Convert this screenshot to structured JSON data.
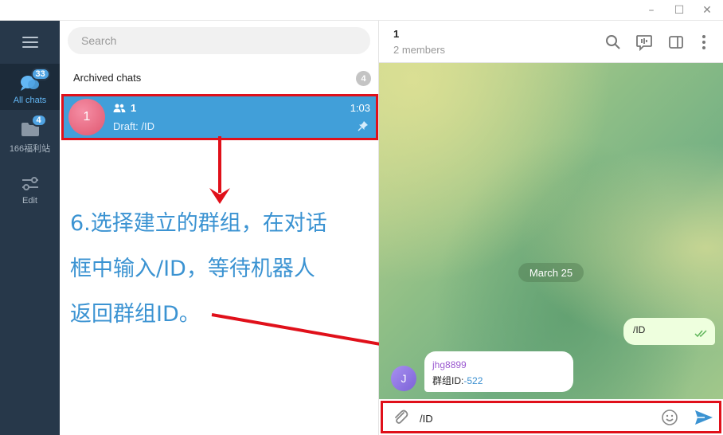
{
  "rail": {
    "items": [
      {
        "label": "All chats",
        "badge": "33",
        "active": true
      },
      {
        "label": "166福利站",
        "badge": "4",
        "active": false
      },
      {
        "label": "Edit",
        "badge": "",
        "active": false
      }
    ]
  },
  "chatlist": {
    "search_placeholder": "Search",
    "archived_label": "Archived chats",
    "archived_count": "4",
    "chats": [
      {
        "avatar_letter": "1",
        "name": "1",
        "time": "1:03",
        "draft": "Draft: /ID",
        "avatar_color": "#e66882"
      }
    ]
  },
  "annotation": {
    "lines": [
      "6.选择建立的群组，在对话",
      "框中输入/ID，等待机器人",
      "返回群组ID。"
    ],
    "color": "#3b93d2",
    "highlight_color": "#e0101a"
  },
  "conversation": {
    "title": "1",
    "subtitle": "2 members",
    "date_label": "March 25",
    "messages": [
      {
        "direction": "out",
        "text": "/ID"
      },
      {
        "direction": "in",
        "sender": "jhg8899",
        "avatar_letter": "J",
        "text_prefix": "群组ID:",
        "text_value": "-522"
      }
    ],
    "composer_value": "/ID"
  },
  "window": {
    "minimize": "–",
    "maximize": "☐",
    "close": "✕"
  }
}
